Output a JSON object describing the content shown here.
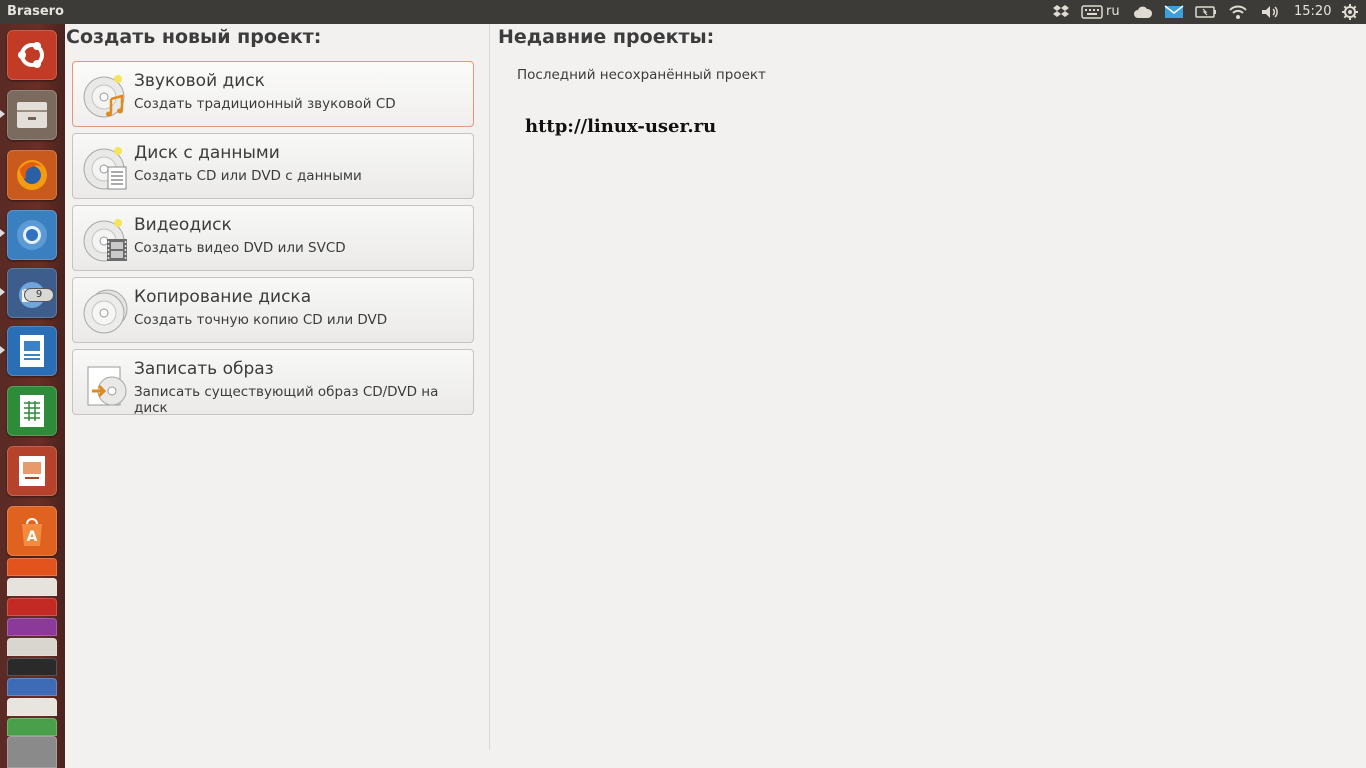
{
  "window": {
    "app_title": "Brasero"
  },
  "top_panel": {
    "keyboard_layout": "ru",
    "clock": "15:20",
    "icons": [
      "dropbox-icon",
      "keyboard-icon",
      "cloud-icon",
      "mail-icon",
      "battery-icon",
      "wifi-icon",
      "volume-icon",
      "gear-icon"
    ]
  },
  "launcher": {
    "items": [
      "ubuntu-dash",
      "files",
      "firefox",
      "chromium",
      "thunderbird",
      "libreoffice-writer",
      "libreoffice-calc",
      "libreoffice-impress",
      "software-center"
    ],
    "thunderbird_badge": "9",
    "stacked": [
      "ubuntu-one",
      "amazon",
      "libreoffice",
      "youtube",
      "ebay",
      "gmail",
      "printer",
      "disc"
    ]
  },
  "new_project": {
    "heading": "Создать новый проект:",
    "items": [
      {
        "title": "Звуковой диск",
        "subtitle": "Создать традиционный звуковой CD",
        "icon": "audio-disc-icon"
      },
      {
        "title": "Диск с данными",
        "subtitle": "Создать CD или DVD с данными",
        "icon": "data-disc-icon"
      },
      {
        "title": "Видеодиск",
        "subtitle": "Создать видео DVD или SVCD",
        "icon": "video-disc-icon"
      },
      {
        "title": "Копирование диска",
        "subtitle": "Создать точную копию CD или DVD",
        "icon": "copy-disc-icon"
      },
      {
        "title": "Записать образ",
        "subtitle": "Записать существующий образ CD/DVD на диск",
        "icon": "burn-image-icon"
      }
    ]
  },
  "recent": {
    "heading": "Недавние проекты:",
    "items": [
      "Последний несохранённый проект"
    ]
  },
  "watermark": "http://linux-user.ru",
  "colors": {
    "panel": "#3c3b37",
    "launcher": "#5e2b24",
    "background": "#f2f1f0",
    "active_border": "#e8957a"
  }
}
